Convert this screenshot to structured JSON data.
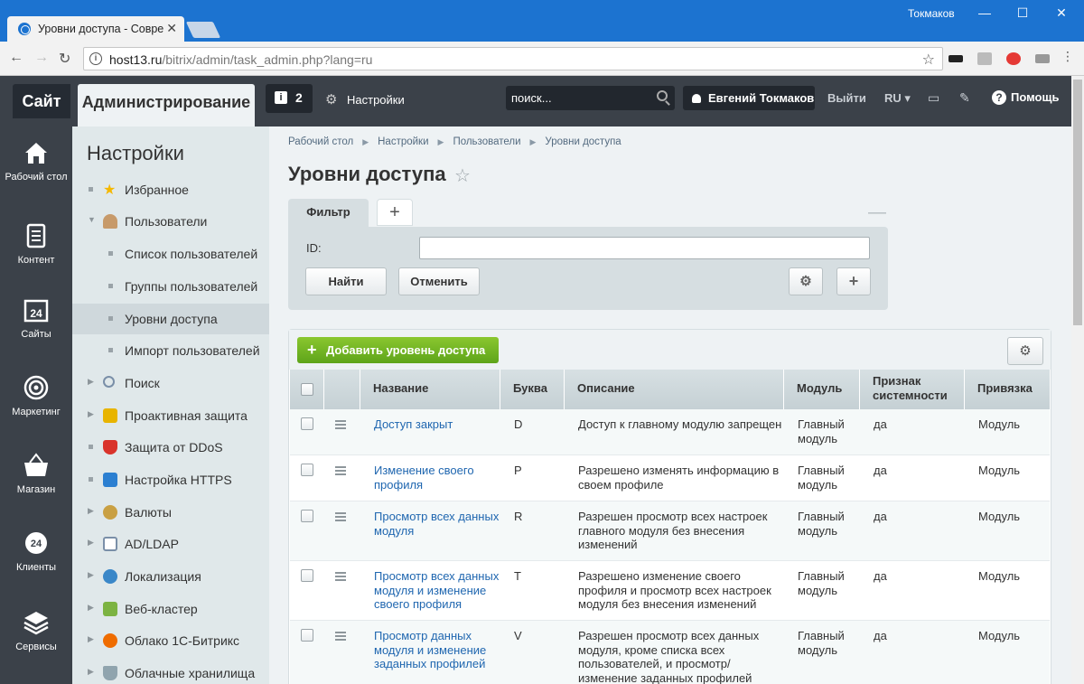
{
  "browser": {
    "tab_title": "Уровни доступа - Совре",
    "tab_close": "✕",
    "window_user": "Токмаков",
    "url_host": "host13.ru",
    "url_path": "/bitrix/admin/task_admin.php?lang=ru",
    "back": "←",
    "forward": "→",
    "reload": "↻",
    "bookmark": "☆",
    "minimize": "—",
    "maximize": "☐",
    "close": "✕"
  },
  "panel": {
    "site_label": "Сайт",
    "admin_label": "Администрирование",
    "notifications_count": "2",
    "notifications_icon": "i",
    "settings_label": "Настройки",
    "search_placeholder": "поиск...",
    "user_name": "Евгений Токмаков",
    "logout_label": "Выйти",
    "lang_label": "RU ▾",
    "help_label": "Помощь"
  },
  "iconnav": [
    {
      "label": "Рабочий стол",
      "icon": "home-icon"
    },
    {
      "label": "Контент",
      "icon": "document-icon"
    },
    {
      "label": "Сайты",
      "icon": "calendar-24-icon"
    },
    {
      "label": "Маркетинг",
      "icon": "target-icon"
    },
    {
      "label": "Магазин",
      "icon": "basket-icon"
    },
    {
      "label": "Клиенты",
      "icon": "clients-24-icon"
    },
    {
      "label": "Сервисы",
      "icon": "layers-icon"
    }
  ],
  "menu": {
    "title": "Настройки",
    "items": [
      {
        "label": "Избранное",
        "icon": "star-icon",
        "color": "#f5b800"
      },
      {
        "label": "Пользователи",
        "icon": "user-icon",
        "color": "#c79a6a"
      },
      {
        "label": "Список пользователей"
      },
      {
        "label": "Группы пользователей"
      },
      {
        "label": "Уровни доступа"
      },
      {
        "label": "Импорт пользователей"
      },
      {
        "label": "Поиск",
        "icon": "search-icon",
        "color": "#7a8fa8"
      },
      {
        "label": "Проактивная защита",
        "icon": "lock-icon",
        "color": "#e8b400"
      },
      {
        "label": "Защита от DDoS",
        "icon": "shield-icon",
        "color": "#d9332b"
      },
      {
        "label": "Настройка HTTPS",
        "icon": "https-icon",
        "color": "#2b7fd1"
      },
      {
        "label": "Валюты",
        "icon": "currency-icon",
        "color": "#c9a043"
      },
      {
        "label": "AD/LDAP",
        "icon": "ldap-icon",
        "color": "#7a8fa8"
      },
      {
        "label": "Локализация",
        "icon": "globe-icon",
        "color": "#3a87c8"
      },
      {
        "label": "Веб-кластер",
        "icon": "cluster-icon",
        "color": "#7cb342"
      },
      {
        "label": "Облако 1С-Битрикс",
        "icon": "cloud-icon",
        "color": "#ef6c00"
      },
      {
        "label": "Облачные хранилища",
        "icon": "flask-icon",
        "color": "#90a4ae"
      }
    ]
  },
  "breadcrumb": [
    "Рабочий стол",
    "Настройки",
    "Пользователи",
    "Уровни доступа"
  ],
  "page": {
    "title": "Уровни доступа",
    "star": "☆"
  },
  "filter": {
    "tab_label": "Фильтр",
    "add_tab": "+",
    "minimize": "—",
    "id_label": "ID:",
    "id_value": "",
    "find_label": "Найти",
    "cancel_label": "Отменить",
    "gear": "⚙",
    "plus": "+"
  },
  "list": {
    "add_label": "Добавить уровень доступа",
    "add_plus": "+",
    "gear": "⚙",
    "columns": {
      "name": "Название",
      "letter": "Буква",
      "description": "Описание",
      "module": "Модуль",
      "system_1": "Признак",
      "system_2": "системности",
      "binding": "Привязка"
    },
    "rows": [
      {
        "name": "Доступ закрыт",
        "letter": "D",
        "description": "Доступ к главному модулю запрещен",
        "module": "Главный модуль",
        "system": "да",
        "binding": "Модуль"
      },
      {
        "name": "Изменение своего профиля",
        "letter": "P",
        "description": "Разрешено изменять информацию в своем профиле",
        "module": "Главный модуль",
        "system": "да",
        "binding": "Модуль"
      },
      {
        "name": "Просмотр всех данных модуля",
        "letter": "R",
        "description": "Разрешен просмотр всех настроек главного модуля без внесения изменений",
        "module": "Главный модуль",
        "system": "да",
        "binding": "Модуль"
      },
      {
        "name": "Просмотр всех данных модуля и изменение своего профиля",
        "letter": "T",
        "description": "Разрешено изменение своего профиля и просмотр всех настроек модуля без внесения изменений",
        "module": "Главный модуль",
        "system": "да",
        "binding": "Модуль"
      },
      {
        "name": "Просмотр данных модуля и изменение заданных профилей",
        "letter": "V",
        "description": "Разрешен просмотр всех данных модуля, кроме списка всех пользователей, и просмотр/ изменение заданных профилей",
        "module": "Главный модуль",
        "system": "да",
        "binding": "Модуль"
      }
    ]
  }
}
